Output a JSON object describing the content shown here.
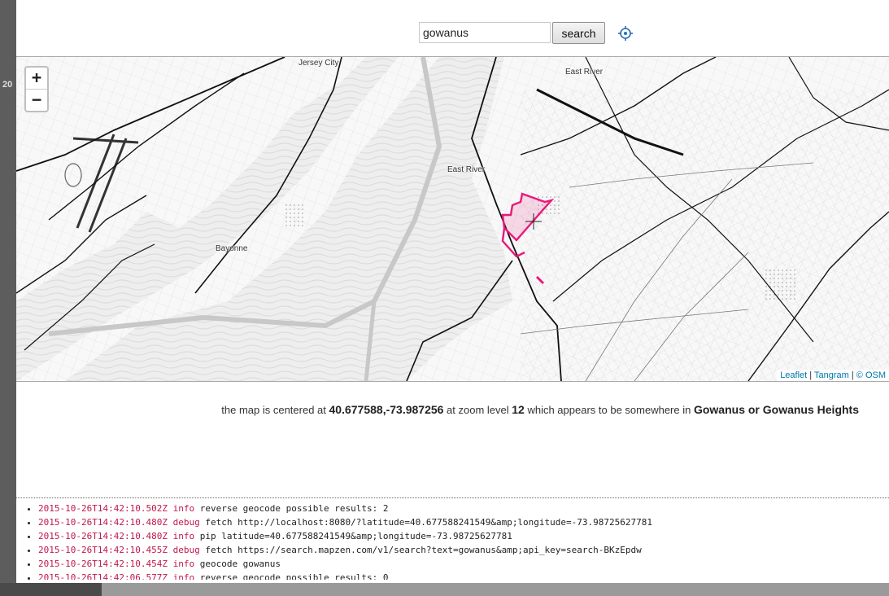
{
  "window": {
    "left_number": "20"
  },
  "search": {
    "value": "gowanus",
    "button_label": "search",
    "locate_icon": "crosshair-icon"
  },
  "map": {
    "zoom_in_label": "+",
    "zoom_out_label": "−",
    "place_labels": {
      "jersey_city": "Jersey City",
      "east_river_1": "East River",
      "east_river_2": "East River",
      "bayonne": "Bayonne"
    },
    "attribution": {
      "leaflet": "Leaflet",
      "sep1": " | ",
      "tangram": "Tangram",
      "sep2": " | ",
      "osm": "© OSM"
    },
    "highlight_color": "#e8197a"
  },
  "status": {
    "prefix": "the map is centered at ",
    "coords": "40.677588,-73.987256",
    "mid": " at zoom level ",
    "zoom": "12",
    "suffix": " which appears to be somewhere in ",
    "place": "Gowanus or Gowanus Heights"
  },
  "logs": [
    {
      "ts": "2015-10-26T14:42:10.502Z",
      "level": "info",
      "msg": "reverse geocode possible results: 2"
    },
    {
      "ts": "2015-10-26T14:42:10.480Z",
      "level": "debug",
      "msg": "fetch http://localhost:8080/?latitude=40.677588241549&amp;longitude=-73.98725627781"
    },
    {
      "ts": "2015-10-26T14:42:10.480Z",
      "level": "info",
      "msg": "pip latitude=40.677588241549&amp;longitude=-73.98725627781"
    },
    {
      "ts": "2015-10-26T14:42:10.455Z",
      "level": "debug",
      "msg": "fetch https://search.mapzen.com/v1/search?text=gowanus&amp;api_key=search-BKzEpdw"
    },
    {
      "ts": "2015-10-26T14:42:10.454Z",
      "level": "info",
      "msg": "geocode gowanus"
    },
    {
      "ts": "2015-10-26T14:42:06.577Z",
      "level": "info",
      "msg": "reverse geocode possible results: 0"
    }
  ]
}
